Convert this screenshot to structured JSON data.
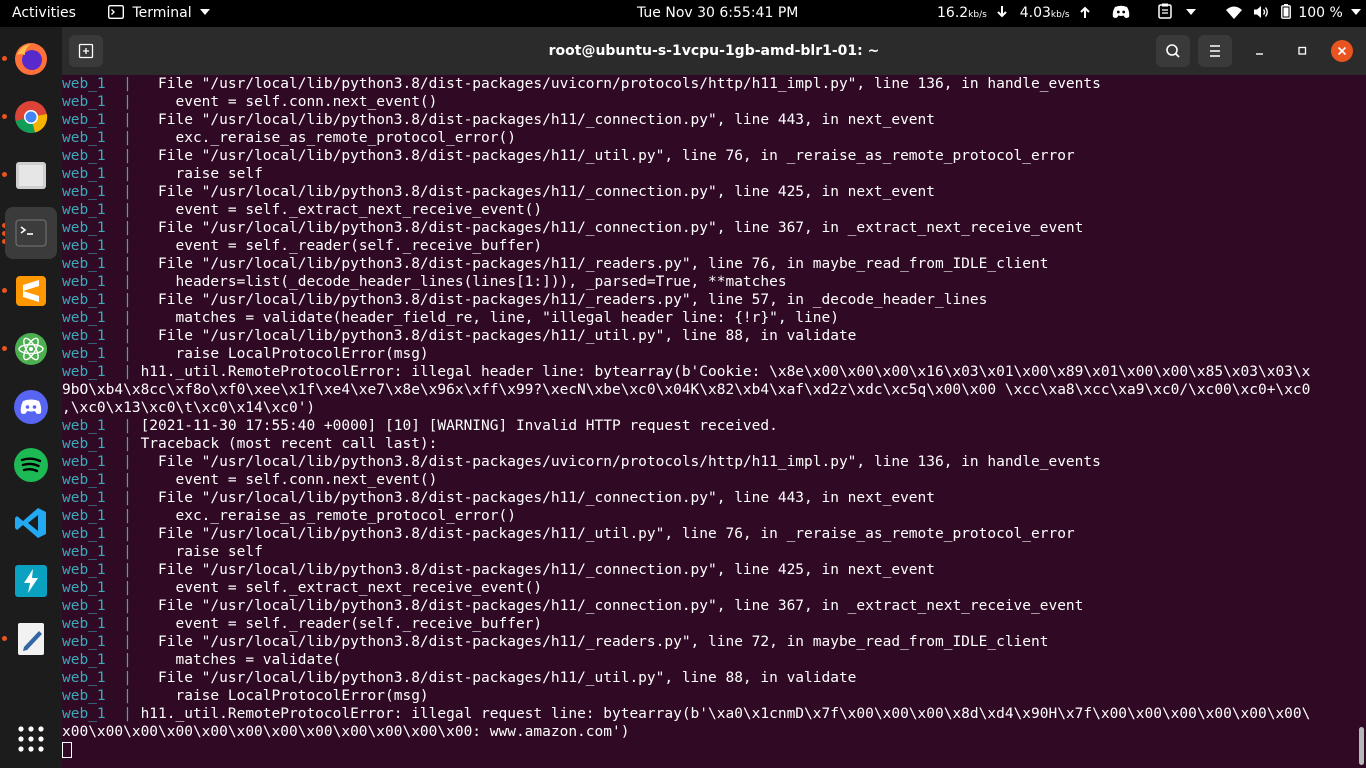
{
  "topbar": {
    "activities": "Activities",
    "app_name": "Terminal",
    "clock": "Tue Nov 30   6:55:41 PM",
    "net_down": "16.2",
    "net_down_unit": "kb/s",
    "net_up": "4.03",
    "net_up_unit": "kb/s",
    "battery": "100 %"
  },
  "dock": {
    "apps": [
      {
        "name": "firefox-icon"
      },
      {
        "name": "chrome-icon"
      },
      {
        "name": "files-icon"
      },
      {
        "name": "terminal-icon"
      },
      {
        "name": "sublime-text-icon"
      },
      {
        "name": "atom-icon"
      },
      {
        "name": "discord-icon"
      },
      {
        "name": "spotify-icon"
      },
      {
        "name": "vscode-icon"
      },
      {
        "name": "zap-icon"
      },
      {
        "name": "text-editor-icon"
      },
      {
        "name": "show-apps-icon"
      }
    ]
  },
  "window": {
    "title": "root@ubuntu-s-1vcpu-1gb-amd-blr1-01: ~"
  },
  "terminal": {
    "prefix": "web_1  | ",
    "lines": [
      "  File \"/usr/local/lib/python3.8/dist-packages/uvicorn/protocols/http/h11_impl.py\", line 136, in handle_events",
      "    event = self.conn.next_event()",
      "  File \"/usr/local/lib/python3.8/dist-packages/h11/_connection.py\", line 443, in next_event",
      "    exc._reraise_as_remote_protocol_error()",
      "  File \"/usr/local/lib/python3.8/dist-packages/h11/_util.py\", line 76, in _reraise_as_remote_protocol_error",
      "    raise self",
      "  File \"/usr/local/lib/python3.8/dist-packages/h11/_connection.py\", line 425, in next_event",
      "    event = self._extract_next_receive_event()",
      "  File \"/usr/local/lib/python3.8/dist-packages/h11/_connection.py\", line 367, in _extract_next_receive_event",
      "    event = self._reader(self._receive_buffer)",
      "  File \"/usr/local/lib/python3.8/dist-packages/h11/_readers.py\", line 76, in maybe_read_from_IDLE_client",
      "    headers=list(_decode_header_lines(lines[1:])), _parsed=True, **matches",
      "  File \"/usr/local/lib/python3.8/dist-packages/h11/_readers.py\", line 57, in _decode_header_lines",
      "    matches = validate(header_field_re, line, \"illegal header line: {!r}\", line)",
      "  File \"/usr/local/lib/python3.8/dist-packages/h11/_util.py\", line 88, in validate",
      "    raise LocalProtocolError(msg)",
      "h11._util.RemoteProtocolError: illegal header line: bytearray(b'Cookie: \\x8e\\x00\\x00\\x00\\x16\\x03\\x01\\x00\\x89\\x01\\x00\\x00\\x85\\x03\\x03\\x",
      "9bO\\xb4\\x8cc\\xf8o\\xf0\\xee\\x1f\\xe4\\xe7\\x8e\\x96x\\xff\\x99?\\xecN\\xbe\\xc0\\x04K\\x82\\xb4\\xaf\\xd2z\\xdc\\xc5q\\x00\\x00 \\xcc\\xa8\\xcc\\xa9\\xc0/\\xc00\\xc0+\\xc0",
      ",\\xc0\\x13\\xc0\\t\\xc0\\x14\\xc0')",
      "[2021-11-30 17:55:40 +0000] [10] [WARNING] Invalid HTTP request received.",
      "Traceback (most recent call last):",
      "  File \"/usr/local/lib/python3.8/dist-packages/uvicorn/protocols/http/h11_impl.py\", line 136, in handle_events",
      "    event = self.conn.next_event()",
      "  File \"/usr/local/lib/python3.8/dist-packages/h11/_connection.py\", line 443, in next_event",
      "    exc._reraise_as_remote_protocol_error()",
      "  File \"/usr/local/lib/python3.8/dist-packages/h11/_util.py\", line 76, in _reraise_as_remote_protocol_error",
      "    raise self",
      "  File \"/usr/local/lib/python3.8/dist-packages/h11/_connection.py\", line 425, in next_event",
      "    event = self._extract_next_receive_event()",
      "  File \"/usr/local/lib/python3.8/dist-packages/h11/_connection.py\", line 367, in _extract_next_receive_event",
      "    event = self._reader(self._receive_buffer)",
      "  File \"/usr/local/lib/python3.8/dist-packages/h11/_readers.py\", line 72, in maybe_read_from_IDLE_client",
      "    matches = validate(",
      "  File \"/usr/local/lib/python3.8/dist-packages/h11/_util.py\", line 88, in validate",
      "    raise LocalProtocolError(msg)",
      "h11._util.RemoteProtocolError: illegal request line: bytearray(b'\\xa0\\x1cnmD\\x7f\\x00\\x00\\x00\\x8d\\xd4\\x90H\\x7f\\x00\\x00\\x00\\x00\\x00\\x00\\",
      "x00\\x00\\x00\\x00\\x00\\x00\\x00\\x00\\x00\\x00\\x00\\x00: www.amazon.com')"
    ],
    "continuation_lines": [
      17,
      18,
      36
    ]
  },
  "colors": {
    "terminal_bg": "#300a24",
    "prefix": "#3aa9b9",
    "accent": "#e95420"
  }
}
